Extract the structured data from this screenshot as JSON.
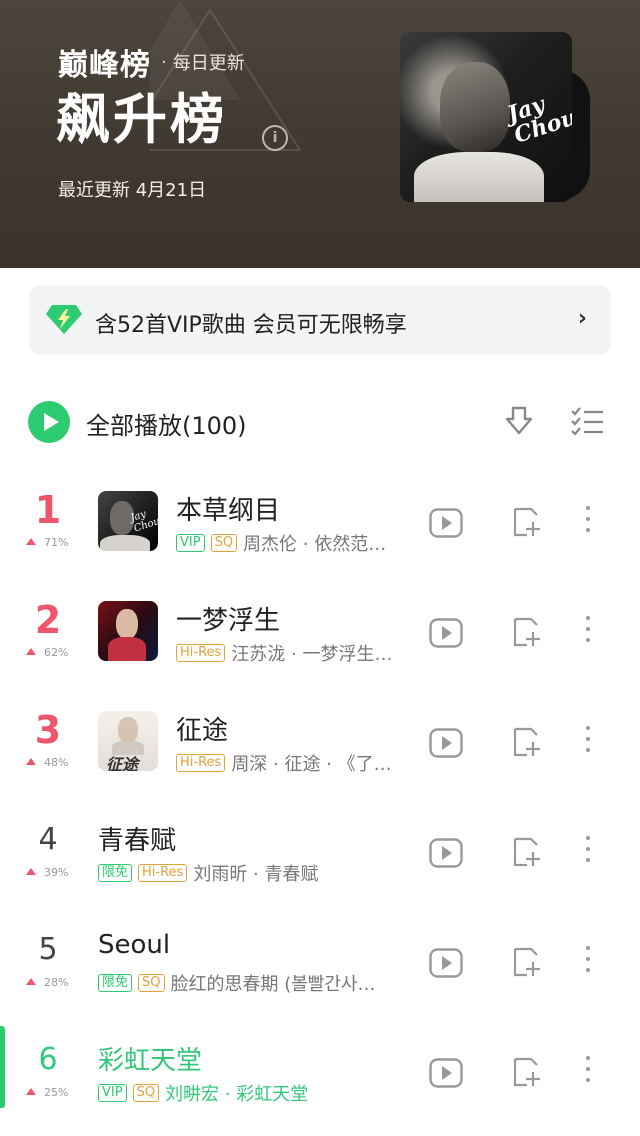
{
  "header": {
    "brand": "巅峰榜",
    "brand_sub": "每日更新",
    "title": "飙升榜",
    "info": "i",
    "update_text": "最近更新 4月21日",
    "cover_text": "Jay Chou"
  },
  "vip_banner": {
    "text": "含52首VIP歌曲 会员可无限畅享",
    "arrow": "›"
  },
  "play_all": {
    "label": "全部播放(100)"
  },
  "songs": [
    {
      "rank": "1",
      "trend": "71%",
      "title": "本草纲目",
      "tags": [
        "VIP",
        "SQ"
      ],
      "artist": "周杰伦 · 依然范…"
    },
    {
      "rank": "2",
      "trend": "62%",
      "title": "一梦浮生",
      "tags": [
        "Hi-Res"
      ],
      "artist": "汪苏泷 · 一梦浮生…"
    },
    {
      "rank": "3",
      "trend": "48%",
      "title": "征途",
      "tags": [
        "Hi-Res"
      ],
      "artist": "周深 · 征途 · 《了…"
    },
    {
      "rank": "4",
      "trend": "39%",
      "title": "青春赋",
      "tags": [
        "限免",
        "Hi-Res"
      ],
      "artist": "刘雨昕 · 青春赋"
    },
    {
      "rank": "5",
      "trend": "28%",
      "title": "Seoul",
      "tags": [
        "限免",
        "SQ"
      ],
      "artist": "脸红的思春期 (볼빨간사…"
    },
    {
      "rank": "6",
      "trend": "25%",
      "title": "彩虹天堂",
      "tags": [
        "VIP",
        "SQ"
      ],
      "artist": "刘畊宏 · 彩虹天堂"
    }
  ],
  "colors": {
    "accent_green": "#2ecc71",
    "rank_red": "#f0566b",
    "tag_gold": "#e4a23b",
    "header_bg": "#3e3830"
  }
}
